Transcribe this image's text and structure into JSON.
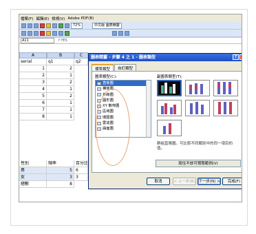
{
  "menubar": [
    "檔案(F)",
    "編輯(E)",
    "檢視(V)",
    "Adobe PDF(B)"
  ],
  "toolbar": {
    "zoom": "72%",
    "fontsize": "中文版 圖表精靈"
  },
  "formula_bar": {
    "namebox": "A11",
    "fx": "f YES"
  },
  "sheet": {
    "columns": [
      "A",
      "B",
      "C"
    ],
    "header_row": [
      "serial",
      "q1",
      "q2"
    ],
    "rows": [
      [
        "1",
        "2",
        ""
      ],
      [
        "2",
        "1",
        ""
      ],
      [
        "3",
        "2",
        ""
      ],
      [
        "4",
        "1",
        ""
      ],
      [
        "5",
        "2",
        ""
      ],
      [
        "6",
        "1",
        ""
      ],
      [
        "7",
        "1",
        ""
      ],
      [
        "8",
        "1",
        ""
      ]
    ],
    "freq_header": [
      "性別",
      "頻率",
      "百分比"
    ],
    "freq_rows": [
      [
        "男",
        "5",
        "6"
      ],
      [
        "女",
        "3",
        "3"
      ],
      [
        "總數",
        "8",
        ""
      ]
    ]
  },
  "dialog": {
    "title": "圖表精靈 - 步驟 4 之 1 - 圖表類型",
    "help": "?",
    "close": "X",
    "tabs": [
      "標準類型",
      "自訂類型"
    ],
    "type_label": "圖表類型(C):",
    "subtype_label": "副圖表類型(T):",
    "chart_types": [
      "直條圖",
      "橫條圖",
      "折線圖",
      "圓形圖",
      "XY 散佈圖",
      "區域圖",
      "環圈圖",
      "雷達圖",
      "曲面圖"
    ],
    "description": "群組直條圖。可比較不同類別中的同一項目的值。",
    "preview_button": "按住不放可預覽範例(V)",
    "buttons": {
      "cancel": "取消",
      "back": "< 上一步(B)",
      "next": "下一步(N) >",
      "finish": "完成(F)"
    }
  },
  "colors": {
    "title_bar": "#1b4fc6",
    "selection": "#316ac5",
    "annotation": "#e8a070"
  }
}
